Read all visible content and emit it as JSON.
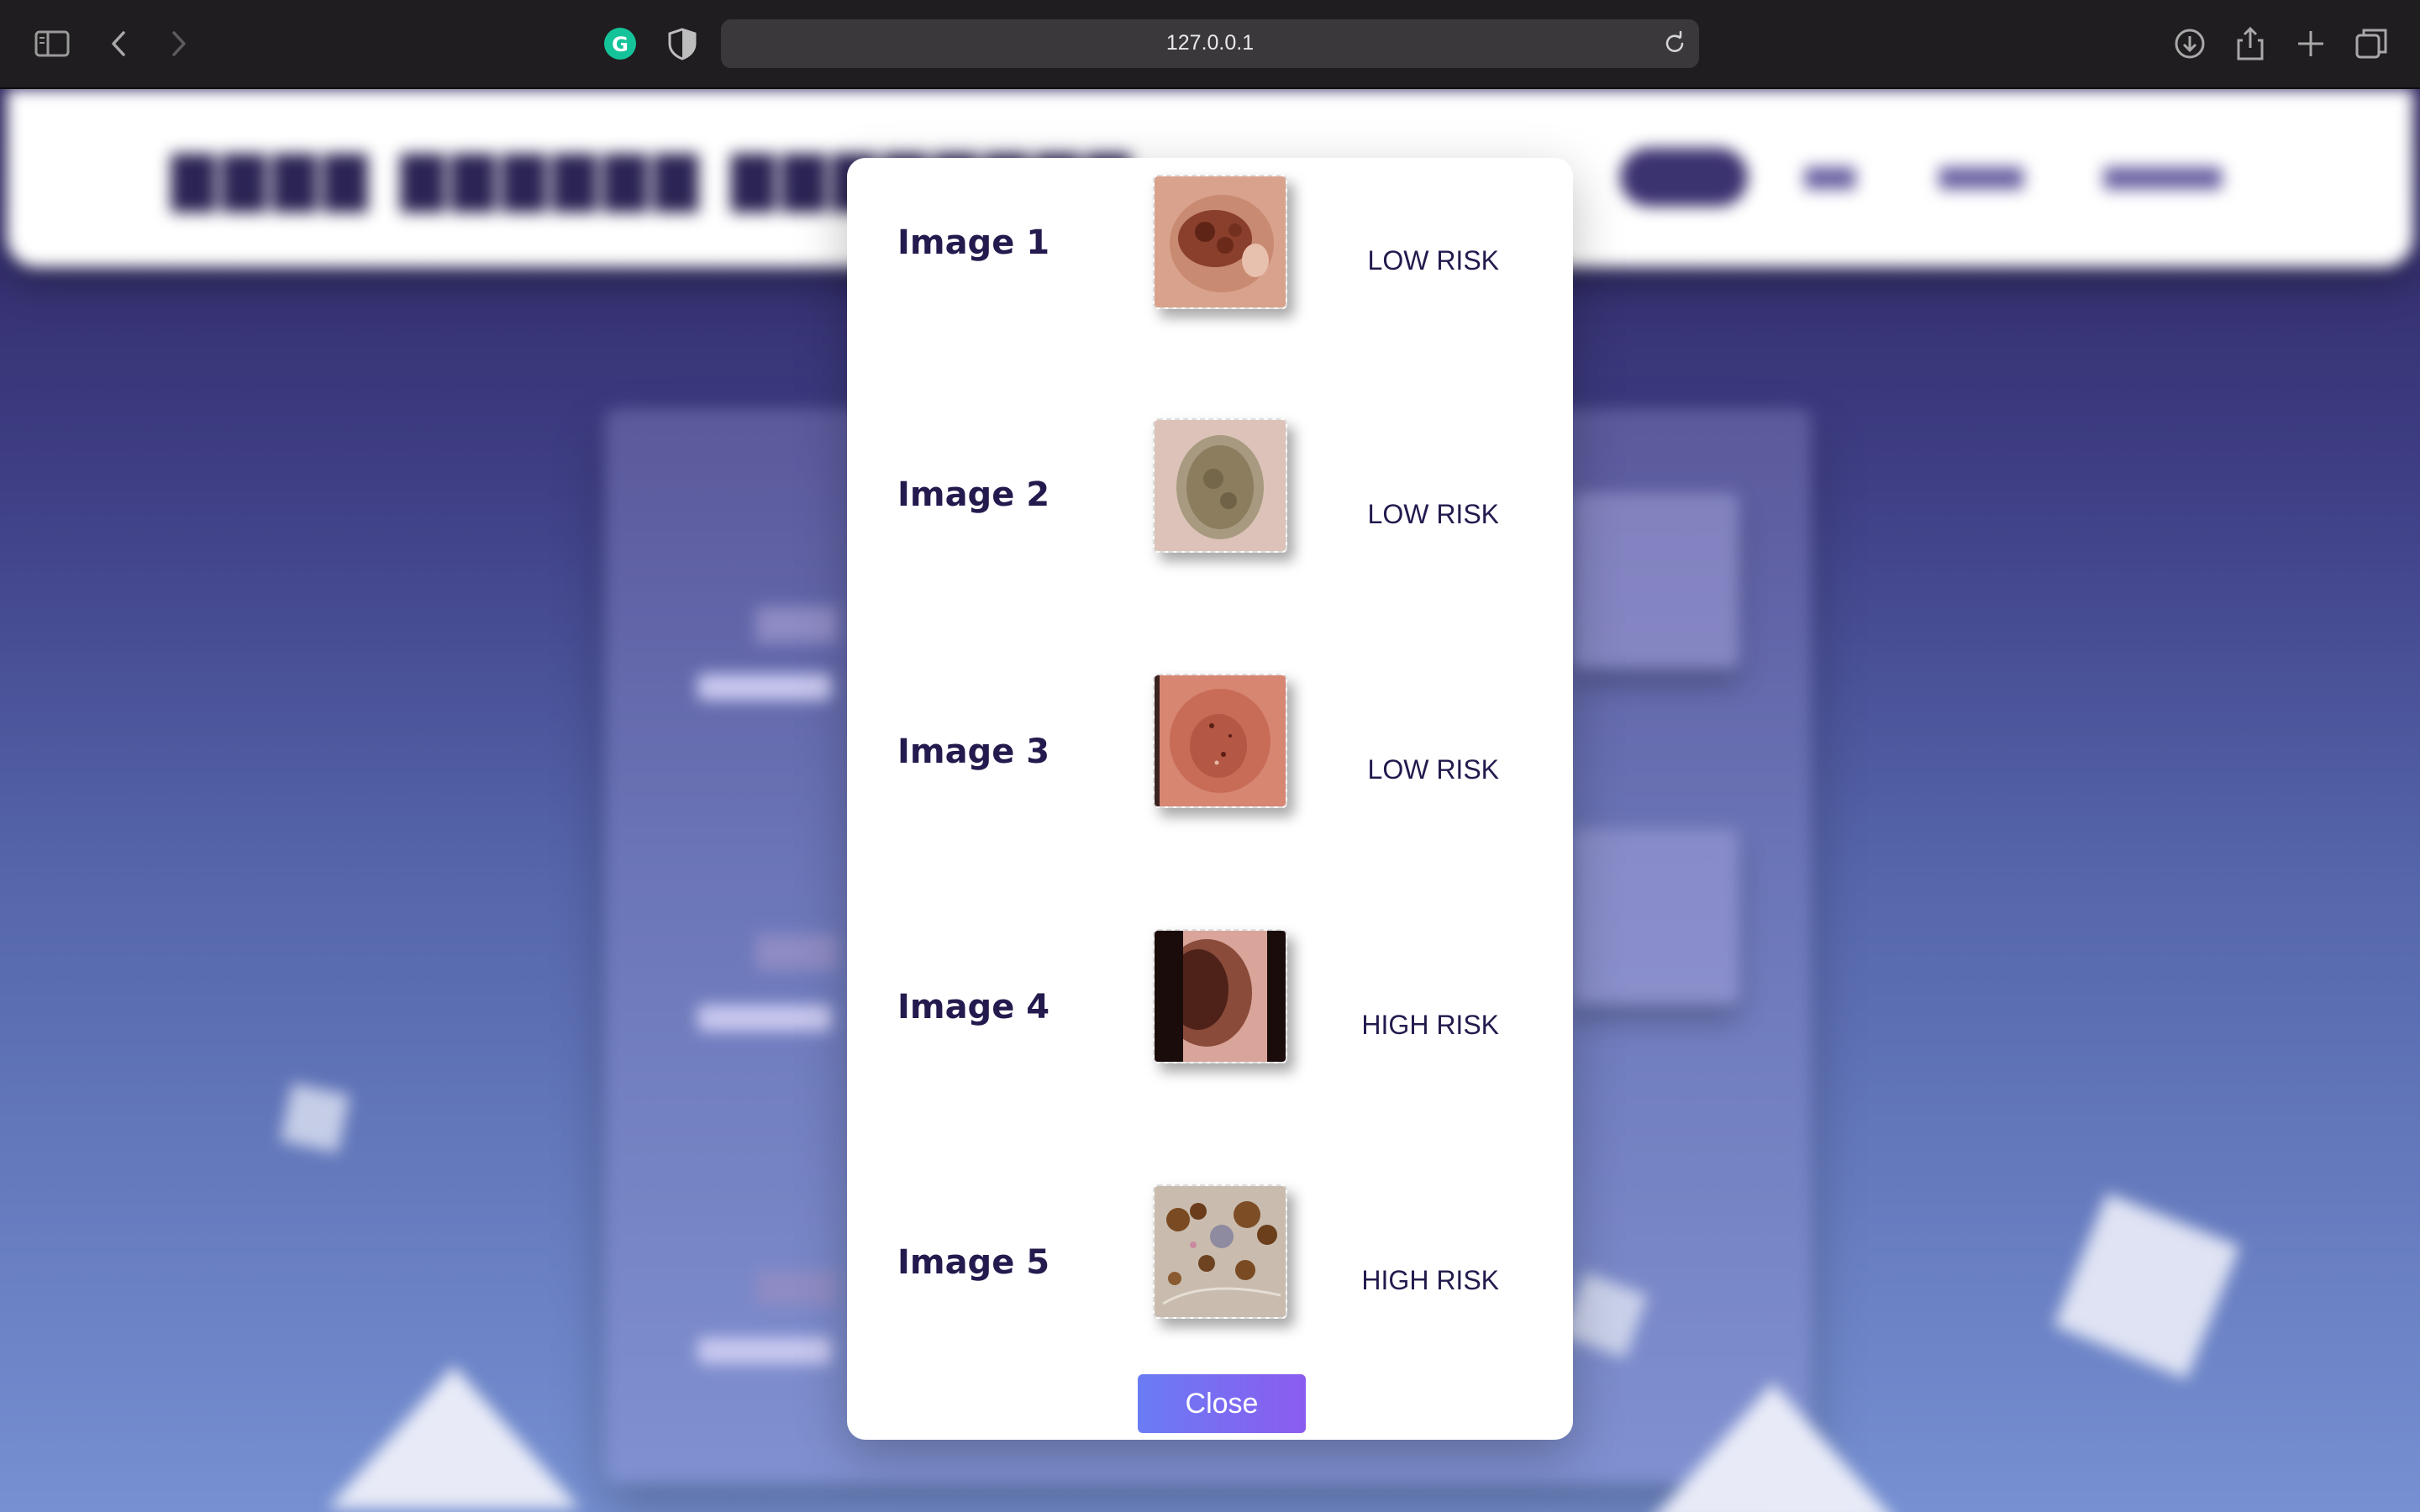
{
  "browser": {
    "url": "127.0.0.1"
  },
  "modal": {
    "results": [
      {
        "label": "Image 1",
        "risk": "LOW RISK"
      },
      {
        "label": "Image 2",
        "risk": "LOW RISK"
      },
      {
        "label": "Image 3",
        "risk": "LOW RISK"
      },
      {
        "label": "Image 4",
        "risk": "HIGH RISK"
      },
      {
        "label": "Image 5",
        "risk": "HIGH RISK"
      }
    ],
    "close_label": "Close"
  },
  "colors": {
    "accent_start": "#6a7cf4",
    "accent_end": "#8b5cf0",
    "heading": "#241a4e"
  }
}
